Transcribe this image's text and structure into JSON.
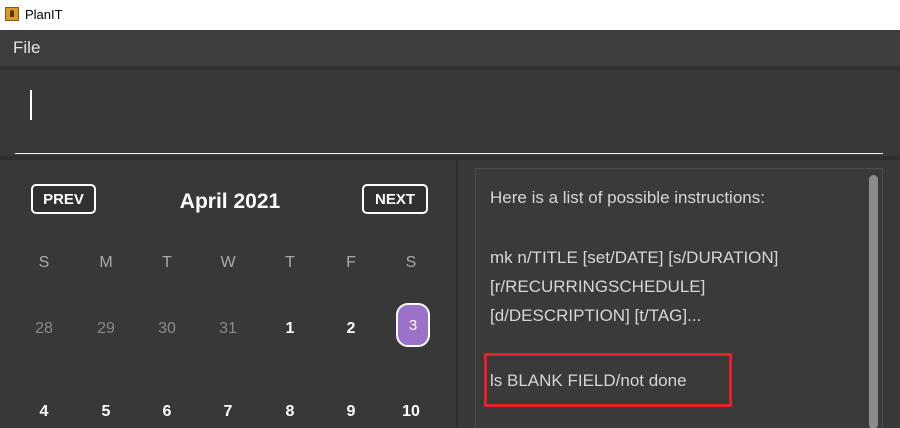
{
  "window": {
    "title": "PlanIT"
  },
  "menu": {
    "file": "File"
  },
  "command": {
    "value": ""
  },
  "calendar": {
    "prev_label": "PREV",
    "next_label": "NEXT",
    "month": "April 2021",
    "weekdays": [
      "S",
      "M",
      "T",
      "W",
      "T",
      "F",
      "S"
    ],
    "week1": [
      "28",
      "29",
      "30",
      "31",
      "1",
      "2",
      "3"
    ],
    "week2": [
      "4",
      "5",
      "6",
      "7",
      "8",
      "9",
      "10"
    ],
    "selected_day": "3"
  },
  "help": {
    "intro": "Here is a list of possible instructions:",
    "mk_line1": "mk n/TITLE [set/DATE] [s/DURATION]",
    "mk_line2": "[r/RECURRINGSCHEDULE]",
    "mk_line3": "[d/DESCRIPTION] [t/TAG]...",
    "ls_line": "ls BLANK FIELD/not done"
  },
  "colors": {
    "menubar": "#3e3e3e",
    "background": "#383838",
    "selected_day": "#9a72c9",
    "highlight": "#e2232a"
  }
}
